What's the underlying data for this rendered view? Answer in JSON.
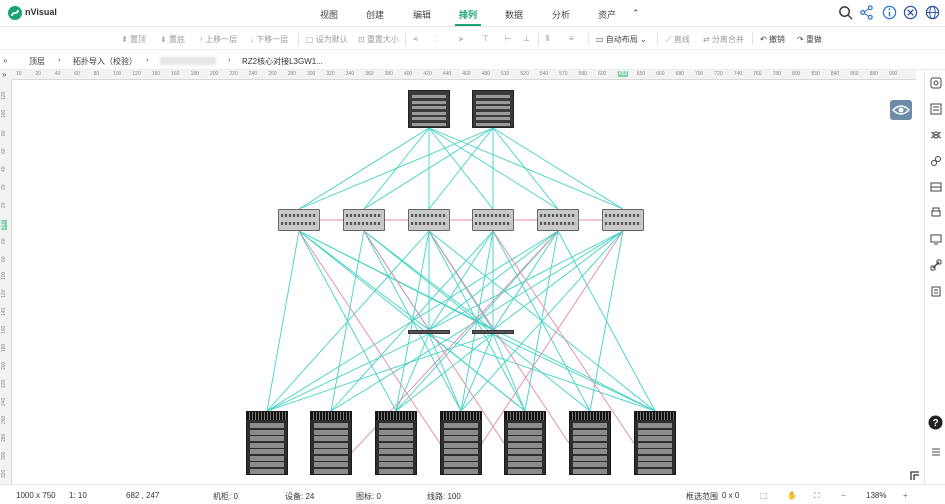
{
  "app": {
    "title": "nVisual"
  },
  "menu": {
    "items": [
      "视图",
      "创建",
      "编辑",
      "排列",
      "数据",
      "分析",
      "资产"
    ],
    "active": "排列",
    "collapse_glyph": "⌃"
  },
  "top_icons": [
    "search-icon",
    "share-icon",
    "info-icon",
    "close-circle-icon",
    "globe-icon"
  ],
  "toolbar": {
    "bring_top": "置顶",
    "send_bottom": "置底",
    "move_up": "上移一层",
    "move_down": "下移一层",
    "set_default": "设为默认",
    "reset_size": "重置大小",
    "auto_layout": "自动布局",
    "straight_line": "直线",
    "separate_merge": "分离合并",
    "undo": "撤销",
    "redo": "重做"
  },
  "breadcrumb": {
    "items": [
      "顶层",
      "拓扑导入（校验）",
      "",
      "RZ2核心对接L3GW1..."
    ]
  },
  "ruler": {
    "h_ticks": [
      "10",
      "20",
      "40",
      "60",
      "80",
      "100",
      "120",
      "150",
      "160",
      "180",
      "200",
      "220",
      "240",
      "260",
      "280",
      "300",
      "320",
      "340",
      "360",
      "380",
      "400",
      "420",
      "440",
      "460",
      "480",
      "510",
      "520",
      "540",
      "570",
      "580",
      "600",
      "620",
      "650",
      "660",
      "680",
      "700",
      "720",
      "740",
      "760",
      "780",
      "800",
      "830",
      "840",
      "860",
      "880",
      "900"
    ],
    "h_marker": "682",
    "v_ticks": [
      "120",
      "100",
      "80",
      "60",
      "40",
      "20",
      "20",
      "40",
      "60",
      "80",
      "100",
      "120",
      "140",
      "160",
      "180",
      "200",
      "220",
      "240",
      "260",
      "280",
      "300",
      "320"
    ],
    "v_marker": "247"
  },
  "status": {
    "canvas_size": "1000 x 750",
    "scale": "1: 10",
    "cursor": "682 , 247",
    "cabinet": "机柜: 0",
    "devices": "设备: 24",
    "icons": "图标: 0",
    "lines": "线路: 100",
    "selection_label": "框选范围",
    "selection_value": "0 x 0",
    "zoom": "138%"
  },
  "colors": {
    "accent": "#1aa373",
    "link_cyan": "#3fd3c4",
    "link_pink": "#e08aa8",
    "eye_panel": "#6e8ca8"
  },
  "right_icons": [
    "eye-icon",
    "layers-icon",
    "bug-icon",
    "link-icon",
    "grid-icon",
    "printer-icon",
    "monitor-icon",
    "chain-icon",
    "clipboard-icon",
    "help-icon",
    "menu-icon",
    "corner-icon"
  ]
}
